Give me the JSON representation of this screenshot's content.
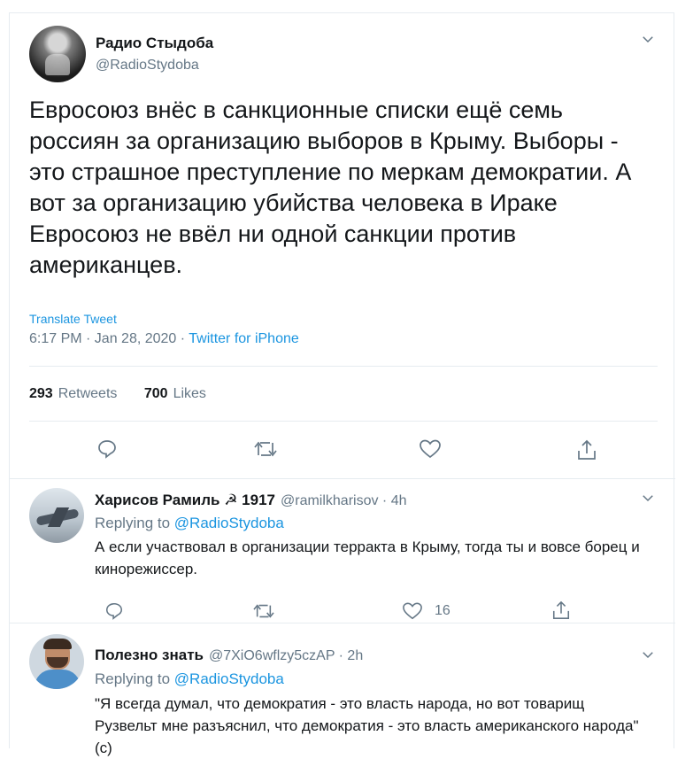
{
  "tweet": {
    "author_name": "Радио Стыдоба",
    "author_handle": "@RadioStydoba",
    "text": "Евросоюз внёс в санкционные списки ещё семь россиян за организацию выборов в Крыму. Выборы - это страшное преступление по меркам демократии. А вот за организацию убийства человека в Ираке Евросоюз не ввёл ни одной санкции против американцев.",
    "translate_label": "Translate Tweet",
    "time": "6:17 PM · Jan 28, 2020 · ",
    "source": "Twitter for iPhone",
    "retweets_count": "293",
    "retweets_label": "Retweets",
    "likes_count": "700",
    "likes_label": "Likes"
  },
  "replies": [
    {
      "name": "Харисов Рамиль ☭ 1917",
      "handle": "@ramilkharisov · 4h",
      "replying_prefix": "Replying to ",
      "replying_to": "@RadioStydoba",
      "text": "А если участвовал в организации терракта в Крыму, тогда ты и вовсе борец и кинорежиссер.",
      "likes": "16"
    },
    {
      "name": "Полезно знать",
      "handle": "@7XiO6wflzy5czAP · 2h",
      "replying_prefix": "Replying to ",
      "replying_to": "@RadioStydoba",
      "text": "\"Я всегда думал, что демократия - это власть народа, но вот товарищ Рузвельт мне разъяснил, что демократия - это власть американского народа\" (с)"
    }
  ],
  "icons": [
    "chevron-down-icon",
    "reply-icon",
    "retweet-icon",
    "like-icon",
    "share-icon"
  ]
}
